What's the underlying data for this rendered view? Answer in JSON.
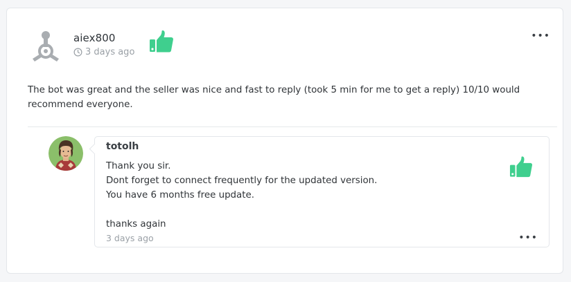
{
  "review": {
    "username": "aiex800",
    "time": "3 days ago",
    "text": "The bot was great and the seller was nice and fast to reply (took 5 min for me to get a reply) 10/10 would recommend everyone.",
    "rating_icon": "thumbs-up-icon",
    "more_label": "•••"
  },
  "reply": {
    "username": "totolh",
    "lines": [
      "Thank you sir.",
      "Dont forget to connect frequently for the updated version.",
      "You have 6 months free update.",
      "",
      "thanks again"
    ],
    "time": "3 days ago",
    "rating_icon": "thumbs-up-icon",
    "more_label": "•••"
  },
  "colors": {
    "thumb_green": "#3fcf8e",
    "muted_text": "#9aa0a6",
    "border": "#e3e6ea"
  }
}
